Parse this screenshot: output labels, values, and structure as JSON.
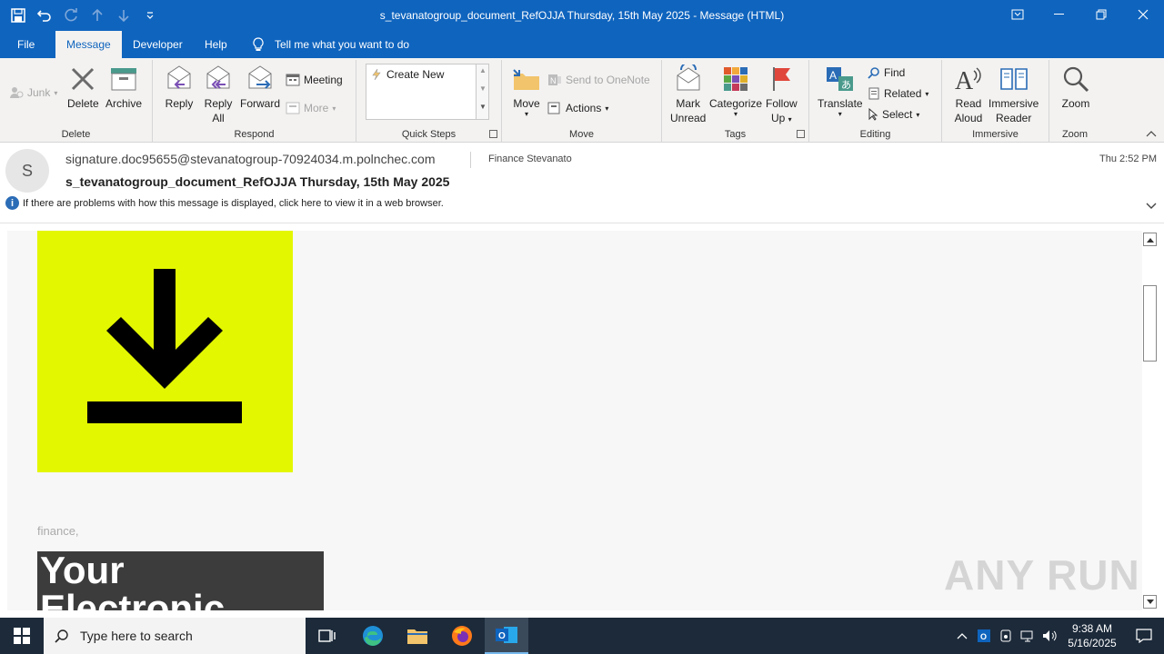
{
  "window": {
    "title": "s_tevanatogroup_document_RefOJJA Thursday, 15th May 2025  -  Message (HTML)"
  },
  "menu": {
    "tabs": [
      {
        "label": "File"
      },
      {
        "label": "Message"
      },
      {
        "label": "Developer"
      },
      {
        "label": "Help"
      }
    ],
    "tell_me": "Tell me what you want to do"
  },
  "ribbon": {
    "delete_group": {
      "label": "Delete",
      "junk": "Junk",
      "delete": "Delete",
      "archive": "Archive"
    },
    "respond_group": {
      "label": "Respond",
      "reply": "Reply",
      "reply_all_1": "Reply",
      "reply_all_2": "All",
      "forward": "Forward",
      "meeting": "Meeting",
      "more": "More"
    },
    "quick_steps_group": {
      "label": "Quick Steps",
      "create_new": "Create New"
    },
    "move_group": {
      "label": "Move",
      "move": "Move",
      "send_onenote": "Send to OneNote",
      "actions": "Actions"
    },
    "tags_group": {
      "label": "Tags",
      "mark_unread_1": "Mark",
      "mark_unread_2": "Unread",
      "categorize": "Categorize",
      "follow_up_1": "Follow",
      "follow_up_2": "Up"
    },
    "editing_group": {
      "label": "Editing",
      "translate": "Translate",
      "find": "Find",
      "related": "Related",
      "select": "Select"
    },
    "immersive_group": {
      "label": "Immersive",
      "read_aloud_1": "Read",
      "read_aloud_2": "Aloud",
      "immersive_reader_1": "Immersive",
      "immersive_reader_2": "Reader"
    },
    "zoom_group": {
      "label": "Zoom",
      "zoom": "Zoom"
    }
  },
  "message": {
    "avatar_initial": "S",
    "from": "signature.doc95655@stevanatogroup-70924034.m.polnchec.com",
    "to": "Finance Stevanato",
    "time": "Thu 2:52 PM",
    "subject": "s_tevanatogroup_document_RefOJJA Thursday, 15th May 2025",
    "info": "If there are problems with how this message is displayed, click here to view it in a web browser."
  },
  "body": {
    "greeting": "finance,",
    "heading_line1": "Your",
    "heading_line2": "Electronic",
    "watermark": "ANY RUN"
  },
  "taskbar": {
    "search_placeholder": "Type here to search",
    "time": "9:38 AM",
    "date": "5/16/2025"
  },
  "colors": {
    "titlebar": "#0f64be",
    "download_bg": "#e3f700",
    "taskbar": "#1c2a3a"
  }
}
